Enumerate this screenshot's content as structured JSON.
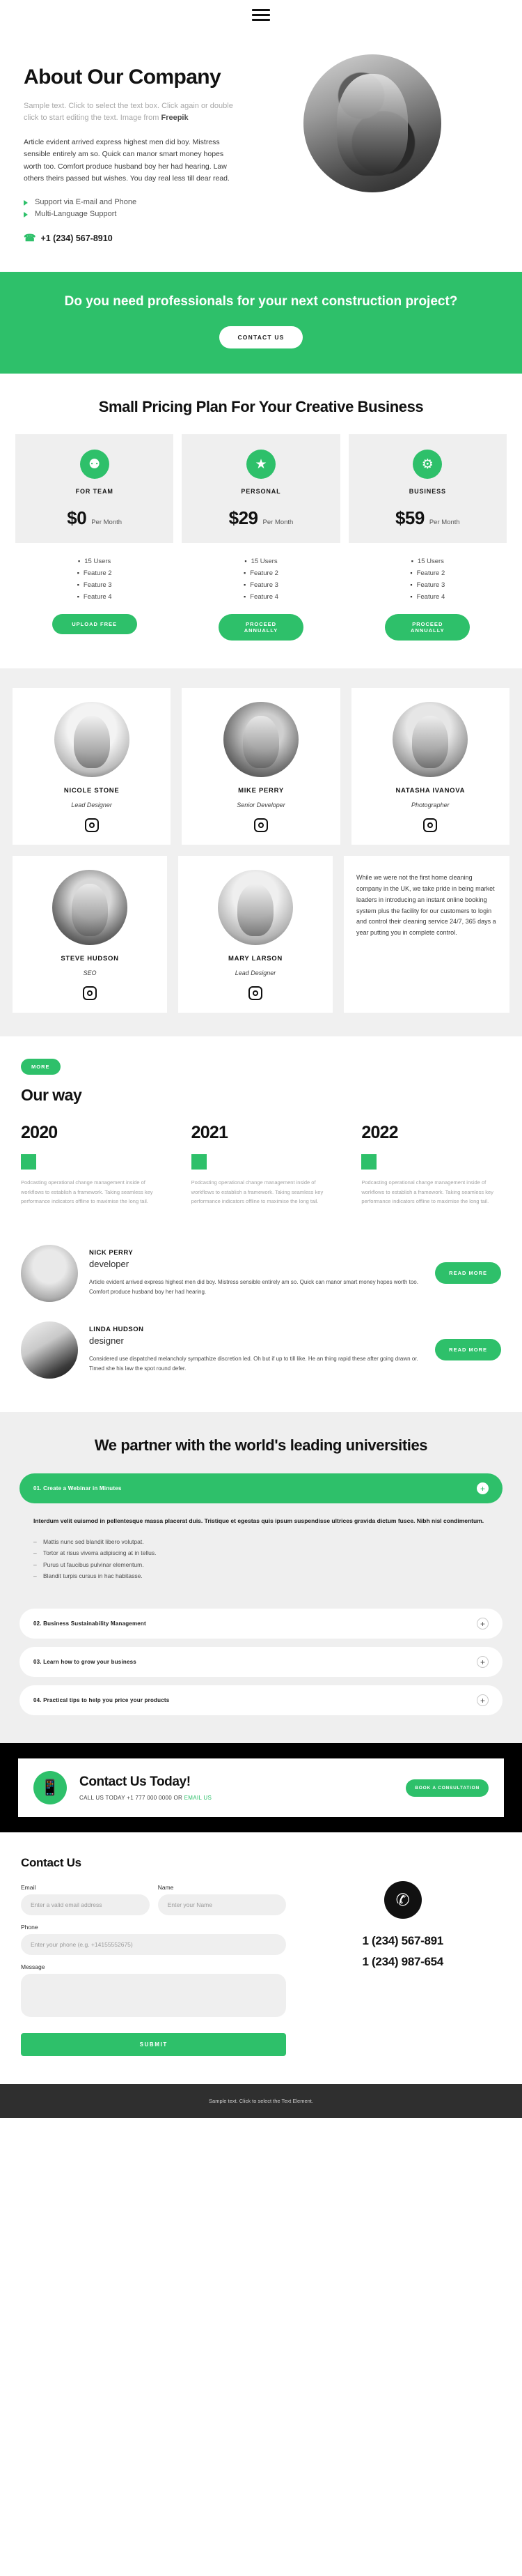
{
  "header": {
    "menu_icon": "hamburger-menu-icon"
  },
  "hero": {
    "title": "About Our Company",
    "sample_prefix": "Sample text. Click to select the text box. Click again or double click to start editing the text. Image from ",
    "sample_link": "Freepik",
    "body": "Article evident arrived express highest men did boy. Mistress sensible entirely am so. Quick can manor smart money hopes worth too. Comfort produce husband boy her had hearing. Law others theirs passed but wishes. You day real less till dear read.",
    "features": [
      "Support via E-mail and Phone",
      "Multi-Language Support"
    ],
    "phone": "+1 (234) 567-8910",
    "phone_icon": "phone-icon",
    "photo_alt": "portrait-photo"
  },
  "cta_band": {
    "heading": "Do you need professionals for your next construction project?",
    "button": "CONTACT US"
  },
  "pricing": {
    "title": "Small Pricing Plan For Your Creative Business",
    "plans": [
      {
        "icon": "location-pin-icon",
        "glyph": "⚉",
        "name": "FOR TEAM",
        "amount": "$0",
        "per": "Per Month",
        "features": [
          "15 Users",
          "Feature 2",
          "Feature 3",
          "Feature 4"
        ],
        "button": "UPLOAD FREE"
      },
      {
        "icon": "star-icon",
        "glyph": "★",
        "name": "PERSONAL",
        "amount": "$29",
        "per": "Per Month",
        "features": [
          "15 Users",
          "Feature 2",
          "Feature 3",
          "Feature 4"
        ],
        "button": "PROCEED ANNUALLY"
      },
      {
        "icon": "gear-icon",
        "glyph": "⚙",
        "name": "BUSINESS",
        "amount": "$59",
        "per": "Per Month",
        "features": [
          "15 Users",
          "Feature 2",
          "Feature 3",
          "Feature 4"
        ],
        "button": "PROCEED ANNUALLY"
      }
    ]
  },
  "team": {
    "members": [
      {
        "name": "NICOLE STONE",
        "role": "Lead Designer",
        "social": "instagram-icon"
      },
      {
        "name": "MIKE PERRY",
        "role": "Senior Developer",
        "social": "instagram-icon"
      },
      {
        "name": "NATASHA IVANOVA",
        "role": "Photographer",
        "social": "instagram-icon"
      },
      {
        "name": "STEVE HUDSON",
        "role": "SEO",
        "social": "instagram-icon"
      },
      {
        "name": "MARY LARSON",
        "role": "Lead Designer",
        "social": "instagram-icon"
      }
    ],
    "quote": "While we were not the first home cleaning company in the UK, we take pride in being market leaders in introducing an instant online booking system plus the facility for our customers to login and control their cleaning service 24/7, 365 days a year putting you in complete control."
  },
  "ourway": {
    "badge": "MORE",
    "title": "Our way",
    "entries": [
      {
        "year": "2020",
        "text": "Podcasting operational change management inside of workflows to establish a framework. Taking seamless key performance indicators offline to maximise the long tail."
      },
      {
        "year": "2021",
        "text": "Podcasting operational change management inside of workflows to establish a framework. Taking seamless key performance indicators offline to maximise the long tail."
      },
      {
        "year": "2022",
        "text": "Podcasting operational change management inside of workflows to establish a framework. Taking seamless key performance indicators offline to maximise the long tail."
      }
    ]
  },
  "blog": {
    "posts": [
      {
        "name": "NICK PERRY",
        "role": "developer",
        "text": "Article evident arrived express highest men did boy. Mistress sensible entirely am so. Quick can manor smart money hopes worth too. Comfort produce husband boy her had hearing.",
        "button": "READ MORE"
      },
      {
        "name": "LINDA HUDSON",
        "role": "designer",
        "text": "Considered use dispatched melancholy sympathize discretion led. Oh but if up to till like. He an thing rapid these after going drawn or. Timed she his law the spot round defer.",
        "button": "READ MORE"
      }
    ]
  },
  "accordion": {
    "title": "We partner with the world's leading universities",
    "items": [
      {
        "label": "01. Create a Webinar in Minutes",
        "state": "open",
        "toggle": "plus-icon"
      },
      {
        "label": "02. Business Sustainability Management",
        "state": "closed",
        "toggle": "plus-icon"
      },
      {
        "label": "03. Learn how to grow your business",
        "state": "closed",
        "toggle": "plus-icon"
      },
      {
        "label": "04. Practical tips to help you price your products",
        "state": "closed",
        "toggle": "plus-icon"
      }
    ],
    "panel": {
      "lead": "Interdum velit euismod in pellentesque massa placerat duis. Tristique et egestas quis ipsum suspendisse ultrices gravida dictum fusce. Nibh nisl condimentum.",
      "bullets": [
        "Mattis nunc sed blandit libero volutpat.",
        "Tortor at risus viverra adipiscing at in tellus.",
        "Purus ut faucibus pulvinar elementum.",
        "Blandit turpis cursus in hac habitasse."
      ]
    }
  },
  "contact_band": {
    "icon": "mobile-phone-icon",
    "title": "Contact Us Today!",
    "sub_prefix": "CALL US TODAY +1 777 000 0000 OR ",
    "sub_link_pre": "EMAIL US",
    "button": "BOOK A CONSULTATION"
  },
  "form": {
    "title": "Contact Us",
    "fields": [
      {
        "label": "Email",
        "placeholder": "Enter a valid email address",
        "value": ""
      },
      {
        "label": "Name",
        "placeholder": "Enter your Name",
        "value": ""
      },
      {
        "label": "Phone",
        "placeholder": "Enter your phone (e.g. +14155552675)",
        "value": ""
      },
      {
        "label": "Message",
        "placeholder": "",
        "value": ""
      }
    ],
    "submit": "SUBMIT",
    "side_icon": "mobile-device-icon",
    "phones": [
      "1 (234) 567-891",
      "1 (234) 987-654"
    ]
  },
  "footer": {
    "text": "Sample text. Click to select the Text Element."
  },
  "colors": {
    "accent": "#2ec06a",
    "dark": "#000000",
    "footer": "#2f2f2f",
    "panel": "#efefef"
  }
}
